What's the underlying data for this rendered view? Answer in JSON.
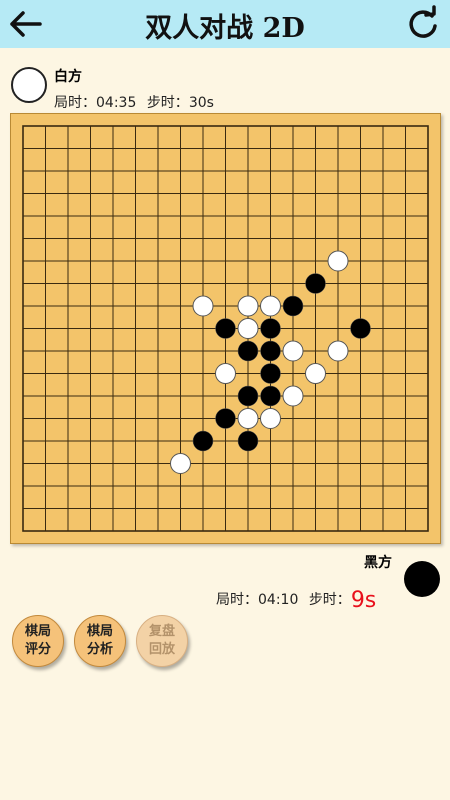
{
  "header": {
    "title": "双人对战 2D"
  },
  "white": {
    "name": "白方",
    "game_time_label": "局时：",
    "game_time": "04:35",
    "step_time_label": "步时：",
    "step_time": "30s"
  },
  "black": {
    "name": "黑方",
    "game_time_label": "局时：",
    "game_time": "04:10",
    "step_time_label": "步时：",
    "step_time": "9s"
  },
  "buttons": [
    {
      "line1": "棋局",
      "line2": "评分",
      "enabled": true
    },
    {
      "line1": "棋局",
      "line2": "分析",
      "enabled": true
    },
    {
      "line1": "复盘",
      "line2": "回放",
      "enabled": false
    }
  ],
  "board": {
    "size": 19,
    "colors": {
      "board": "#f3c46a",
      "line": "#3a2a10",
      "black": "#000000",
      "white": "#ffffff"
    },
    "stones": [
      {
        "c": 14,
        "r": 6,
        "color": "white"
      },
      {
        "c": 13,
        "r": 7,
        "color": "black"
      },
      {
        "c": 8,
        "r": 8,
        "color": "white"
      },
      {
        "c": 10,
        "r": 8,
        "color": "white"
      },
      {
        "c": 11,
        "r": 8,
        "color": "white"
      },
      {
        "c": 12,
        "r": 8,
        "color": "black"
      },
      {
        "c": 9,
        "r": 9,
        "color": "black"
      },
      {
        "c": 10,
        "r": 9,
        "color": "white"
      },
      {
        "c": 11,
        "r": 9,
        "color": "black"
      },
      {
        "c": 15,
        "r": 9,
        "color": "black"
      },
      {
        "c": 10,
        "r": 10,
        "color": "black"
      },
      {
        "c": 11,
        "r": 10,
        "color": "black"
      },
      {
        "c": 12,
        "r": 10,
        "color": "white"
      },
      {
        "c": 14,
        "r": 10,
        "color": "white"
      },
      {
        "c": 9,
        "r": 11,
        "color": "white"
      },
      {
        "c": 11,
        "r": 11,
        "color": "black"
      },
      {
        "c": 13,
        "r": 11,
        "color": "white"
      },
      {
        "c": 10,
        "r": 12,
        "color": "black"
      },
      {
        "c": 11,
        "r": 12,
        "color": "black"
      },
      {
        "c": 12,
        "r": 12,
        "color": "white"
      },
      {
        "c": 9,
        "r": 13,
        "color": "black"
      },
      {
        "c": 10,
        "r": 13,
        "color": "white"
      },
      {
        "c": 11,
        "r": 13,
        "color": "white"
      },
      {
        "c": 8,
        "r": 14,
        "color": "black"
      },
      {
        "c": 10,
        "r": 14,
        "color": "black"
      },
      {
        "c": 7,
        "r": 15,
        "color": "white"
      }
    ]
  }
}
